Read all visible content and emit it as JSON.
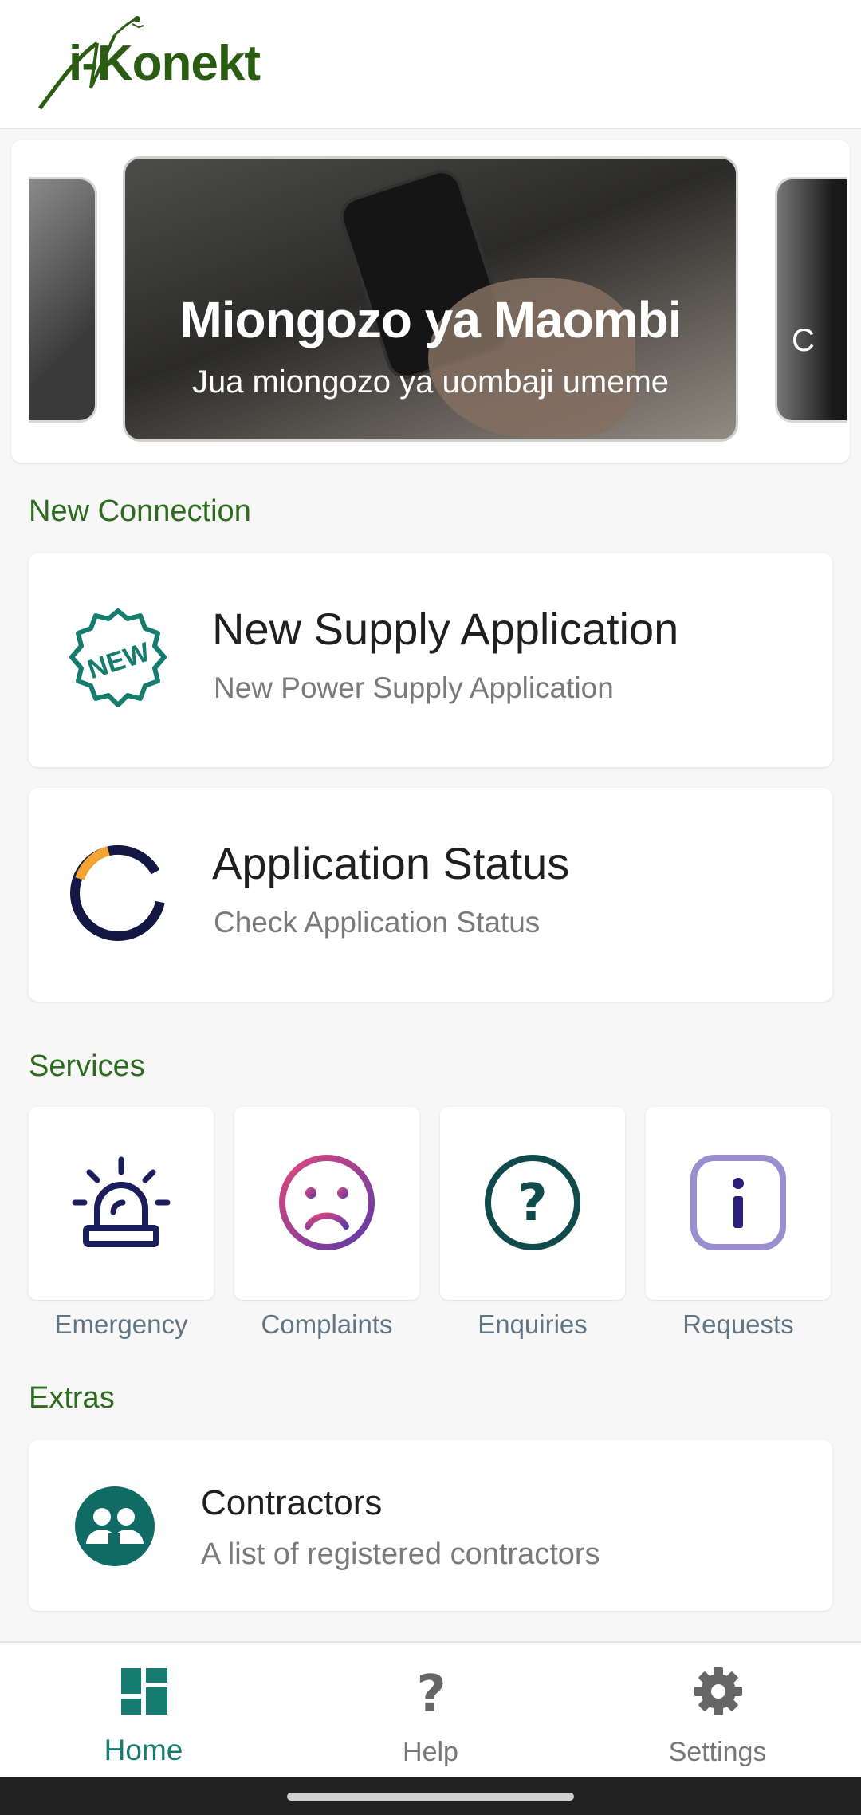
{
  "header": {
    "logo_text": "i-Konekt"
  },
  "carousel": {
    "slides": [
      {
        "title": "Miongozo ya Maombi",
        "subtitle": "Jua miongozo ya uombaji umeme"
      }
    ],
    "next_slide_fragment": "C"
  },
  "new_connection": {
    "title": "New Connection",
    "cards": [
      {
        "title": "New Supply Application",
        "subtitle": "New Power Supply Application",
        "icon": "new-badge-icon"
      },
      {
        "title": "Application Status",
        "subtitle": "Check Application Status",
        "icon": "status-ring-icon"
      }
    ]
  },
  "services": {
    "title": "Services",
    "items": [
      {
        "label": "Emergency",
        "icon": "siren-icon"
      },
      {
        "label": "Complaints",
        "icon": "sad-face-icon"
      },
      {
        "label": "Enquiries",
        "icon": "question-icon"
      },
      {
        "label": "Requests",
        "icon": "info-icon"
      }
    ]
  },
  "extras": {
    "title": "Extras",
    "cards": [
      {
        "title": "Contractors",
        "subtitle": "A list of registered contractors",
        "icon": "people-icon"
      }
    ]
  },
  "bottom_nav": {
    "items": [
      {
        "label": "Home",
        "icon": "dashboard-icon",
        "active": true
      },
      {
        "label": "Help",
        "icon": "help-icon",
        "active": false
      },
      {
        "label": "Settings",
        "icon": "gear-icon",
        "active": false
      }
    ]
  },
  "colors": {
    "brand_green": "#2d6b1e",
    "accent_teal": "#177c70",
    "navy": "#1a1f5c"
  }
}
